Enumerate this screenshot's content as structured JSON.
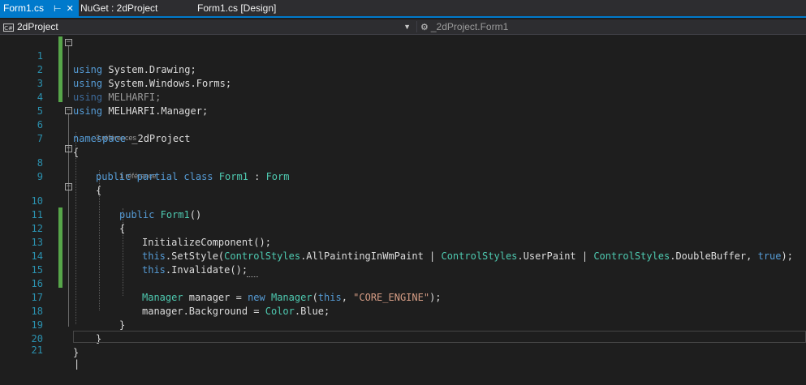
{
  "tabs": [
    {
      "label": "Form1.cs",
      "active": true
    },
    {
      "label": "NuGet : 2dProject",
      "active": false
    },
    {
      "label": "Form1.cs [Design]",
      "active": false
    }
  ],
  "tab_icons": {
    "pin": "pin-icon",
    "close": "close-icon"
  },
  "navbar": {
    "project_icon": "C#",
    "project": "2dProject",
    "type_member": "_2dProject.Form1"
  },
  "codelens": {
    "class_refs": "3 références",
    "ctor_refs": "1 référence"
  },
  "line_numbers": [
    "1",
    "2",
    "3",
    "4",
    "5",
    "6",
    "7",
    "8",
    "9",
    "10",
    "11",
    "12",
    "13",
    "14",
    "15",
    "16",
    "17",
    "18",
    "19",
    "20",
    "21"
  ],
  "code": {
    "l1": {
      "kw": "using",
      "rest": " System.Drawing;"
    },
    "l2": {
      "kw": "using",
      "rest": " System.Windows.Forms;"
    },
    "l3": {
      "kw": "using",
      "rest": " MELHARFI;"
    },
    "l4": {
      "kw": "using",
      "rest": " MELHARFI.Manager;"
    },
    "l6": {
      "kw": "namespace",
      "rest": " _2dProject"
    },
    "l7": "{",
    "l8": {
      "kw1": "public",
      "kw2": "partial",
      "kw3": "class",
      "type": "Form1",
      "colon": " : ",
      "base": "Form"
    },
    "l9": "{",
    "l10": {
      "kw": "public",
      "type": "Form1",
      "rest": "()"
    },
    "l11": "{",
    "l12": "InitializeComponent();",
    "l13": {
      "this": "this",
      "p1": ".SetStyle(",
      "t1": "ControlStyles",
      "p2": ".AllPaintingInWmPaint | ",
      "t2": "ControlStyles",
      "p3": ".UserPaint | ",
      "t3": "ControlStyles",
      "p4": ".DoubleBuffer, ",
      "tru": "true",
      "p5": ");"
    },
    "l14": {
      "this": "this",
      "rest": ".Invalidate();"
    },
    "l16": {
      "t1": "Manager",
      "p1": " manager = ",
      "new": "new",
      "sp": " ",
      "t2": "Manager",
      "p2": "(",
      "this": "this",
      "p3": ", ",
      "str": "\"CORE_ENGINE\"",
      "p4": ");"
    },
    "l17": {
      "p1": "manager.Background = ",
      "t1": "Color",
      "p2": ".Blue;"
    },
    "l18": "}",
    "l19": "}",
    "l20": "}"
  },
  "colors": {
    "background": "#1e1e1e",
    "keyword": "#569cd6",
    "type": "#4ec9b0",
    "string": "#d69d85",
    "line_number": "#2b91af",
    "accent": "#007acc",
    "change_bar": "#57a64a"
  }
}
